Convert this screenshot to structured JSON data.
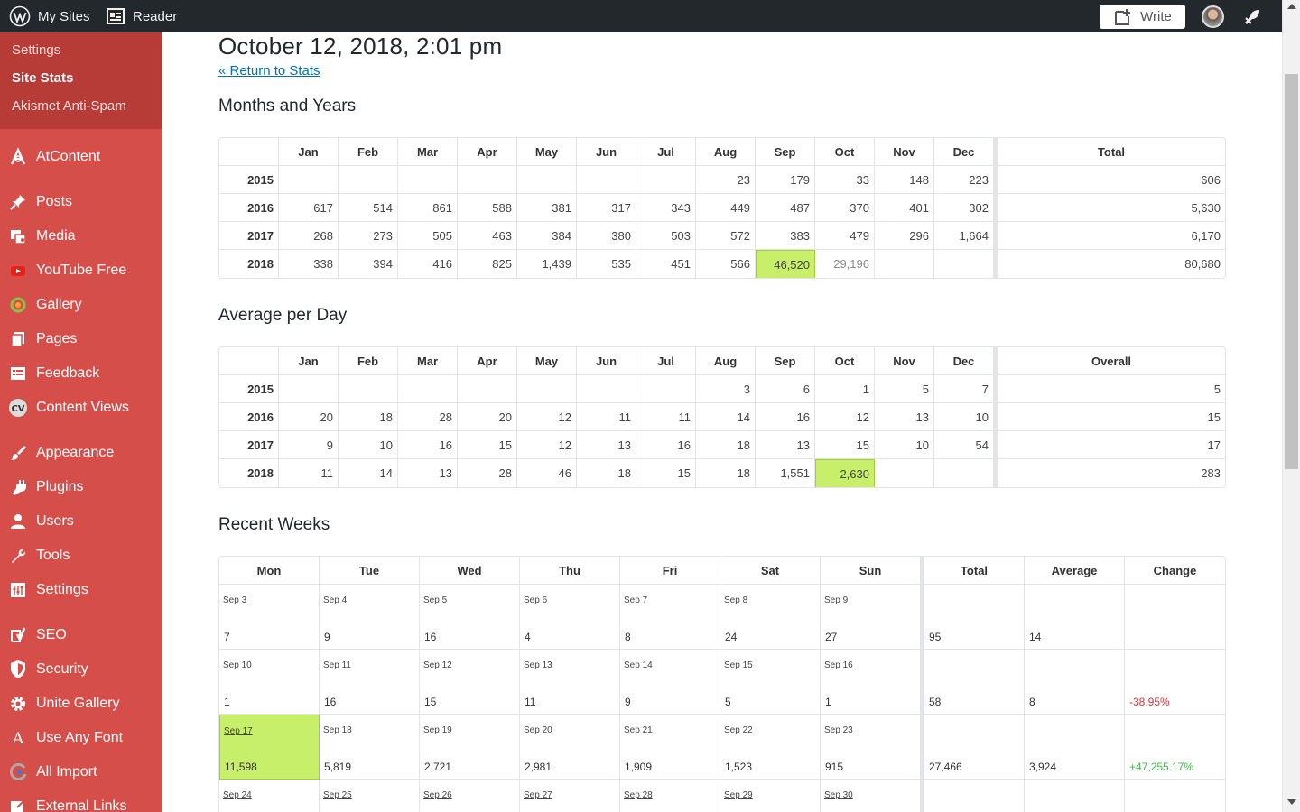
{
  "topbar": {
    "my_sites": "My Sites",
    "reader": "Reader",
    "write": "Write"
  },
  "sidebar": {
    "submenu": [
      "Settings",
      "Site Stats",
      "Akismet Anti-Spam"
    ],
    "active_sub": "Site Stats",
    "groups": [
      [
        {
          "label": "AtContent",
          "icon": "atcontent-icon"
        }
      ],
      [
        {
          "label": "Posts",
          "icon": "pushpin-icon"
        },
        {
          "label": "Media",
          "icon": "media-icon"
        },
        {
          "label": "YouTube Free",
          "icon": "youtube-icon"
        },
        {
          "label": "Gallery",
          "icon": "gallery-icon"
        },
        {
          "label": "Pages",
          "icon": "pages-icon"
        },
        {
          "label": "Feedback",
          "icon": "feedback-icon"
        },
        {
          "label": "Content Views",
          "icon": "cv-icon"
        }
      ],
      [
        {
          "label": "Appearance",
          "icon": "paintbrush-icon"
        },
        {
          "label": "Plugins",
          "icon": "plugin-icon"
        },
        {
          "label": "Users",
          "icon": "user-icon"
        },
        {
          "label": "Tools",
          "icon": "wrench-icon"
        },
        {
          "label": "Settings",
          "icon": "settings-icon"
        }
      ],
      [
        {
          "label": "SEO",
          "icon": "yoast-icon"
        },
        {
          "label": "Security",
          "icon": "shield-icon"
        },
        {
          "label": "Unite Gallery",
          "icon": "gear-icon"
        },
        {
          "label": "Use Any Font",
          "icon": "font-icon"
        },
        {
          "label": "All Import",
          "icon": "import-icon"
        },
        {
          "label": "External Links",
          "icon": "external-link-icon"
        }
      ]
    ]
  },
  "page": {
    "title": "October 12, 2018, 2:01 pm",
    "return_link": "« Return to Stats"
  },
  "months_years": {
    "title": "Months and Years",
    "headers": [
      "Jan",
      "Feb",
      "Mar",
      "Apr",
      "May",
      "Jun",
      "Jul",
      "Aug",
      "Sep",
      "Oct",
      "Nov",
      "Dec"
    ],
    "total_header": "Total",
    "rows": [
      {
        "year": "2015",
        "values": [
          "",
          "",
          "",
          "",
          "",
          "",
          "",
          "23",
          "179",
          "33",
          "148",
          "223"
        ],
        "total": "606"
      },
      {
        "year": "2016",
        "values": [
          "617",
          "514",
          "861",
          "588",
          "381",
          "317",
          "343",
          "449",
          "487",
          "370",
          "401",
          "302"
        ],
        "total": "5,630"
      },
      {
        "year": "2017",
        "values": [
          "268",
          "273",
          "505",
          "463",
          "384",
          "380",
          "503",
          "572",
          "383",
          "479",
          "296",
          "1,664"
        ],
        "total": "6,170"
      },
      {
        "year": "2018",
        "values": [
          "338",
          "394",
          "416",
          "825",
          "1,439",
          "535",
          "451",
          "566",
          "46,520",
          "29,196",
          "",
          ""
        ],
        "total": "80,680",
        "highlight": 8,
        "muted": 9
      }
    ]
  },
  "avg_day": {
    "title": "Average per Day",
    "headers": [
      "Jan",
      "Feb",
      "Mar",
      "Apr",
      "May",
      "Jun",
      "Jul",
      "Aug",
      "Sep",
      "Oct",
      "Nov",
      "Dec"
    ],
    "total_header": "Overall",
    "rows": [
      {
        "year": "2015",
        "values": [
          "",
          "",
          "",
          "",
          "",
          "",
          "",
          "3",
          "6",
          "1",
          "5",
          "7"
        ],
        "total": "5"
      },
      {
        "year": "2016",
        "values": [
          "20",
          "18",
          "28",
          "20",
          "12",
          "11",
          "11",
          "14",
          "16",
          "12",
          "13",
          "10"
        ],
        "total": "15"
      },
      {
        "year": "2017",
        "values": [
          "9",
          "10",
          "16",
          "15",
          "12",
          "13",
          "16",
          "18",
          "13",
          "15",
          "10",
          "54"
        ],
        "total": "17"
      },
      {
        "year": "2018",
        "values": [
          "11",
          "14",
          "13",
          "28",
          "46",
          "18",
          "15",
          "18",
          "1,551",
          "2,630",
          "",
          ""
        ],
        "total": "283",
        "highlight": 9
      }
    ]
  },
  "recent_weeks": {
    "title": "Recent Weeks",
    "headers": [
      "Mon",
      "Tue",
      "Wed",
      "Thu",
      "Fri",
      "Sat",
      "Sun"
    ],
    "summary_headers": [
      "Total",
      "Average",
      "Change"
    ],
    "weeks": [
      {
        "days": [
          {
            "d": "Sep 3",
            "v": "7"
          },
          {
            "d": "Sep 4",
            "v": "9"
          },
          {
            "d": "Sep 5",
            "v": "16"
          },
          {
            "d": "Sep 6",
            "v": "4"
          },
          {
            "d": "Sep 7",
            "v": "8"
          },
          {
            "d": "Sep 8",
            "v": "24"
          },
          {
            "d": "Sep 9",
            "v": "27"
          }
        ],
        "total": "95",
        "average": "14",
        "change": "",
        "change_sign": ""
      },
      {
        "days": [
          {
            "d": "Sep 10",
            "v": "1"
          },
          {
            "d": "Sep 11",
            "v": "16"
          },
          {
            "d": "Sep 12",
            "v": "15"
          },
          {
            "d": "Sep 13",
            "v": "11"
          },
          {
            "d": "Sep 14",
            "v": "9"
          },
          {
            "d": "Sep 15",
            "v": "5"
          },
          {
            "d": "Sep 16",
            "v": "1"
          }
        ],
        "total": "58",
        "average": "8",
        "change": "-38.95%",
        "change_sign": "neg"
      },
      {
        "days": [
          {
            "d": "Sep 17",
            "v": "11,598",
            "hl": true
          },
          {
            "d": "Sep 18",
            "v": "5,819"
          },
          {
            "d": "Sep 19",
            "v": "2,721"
          },
          {
            "d": "Sep 20",
            "v": "2,981"
          },
          {
            "d": "Sep 21",
            "v": "1,909"
          },
          {
            "d": "Sep 22",
            "v": "1,523"
          },
          {
            "d": "Sep 23",
            "v": "915"
          }
        ],
        "total": "27,466",
        "average": "3,924",
        "change": "+47,255.17%",
        "change_sign": "pos"
      },
      {
        "days": [
          {
            "d": "Sep 24",
            "v": ""
          },
          {
            "d": "Sep 25",
            "v": ""
          },
          {
            "d": "Sep 26",
            "v": ""
          },
          {
            "d": "Sep 27",
            "v": ""
          },
          {
            "d": "Sep 28",
            "v": ""
          },
          {
            "d": "Sep 29",
            "v": ""
          },
          {
            "d": "Sep 30",
            "v": ""
          }
        ],
        "total": "",
        "average": "",
        "change": "",
        "change_sign": ""
      }
    ]
  },
  "colors": {
    "sidebar": "#d54e49",
    "submenu": "#b73c37",
    "topbar": "#23282d",
    "highlight": "#c8ef6a",
    "link": "#0073aa"
  }
}
